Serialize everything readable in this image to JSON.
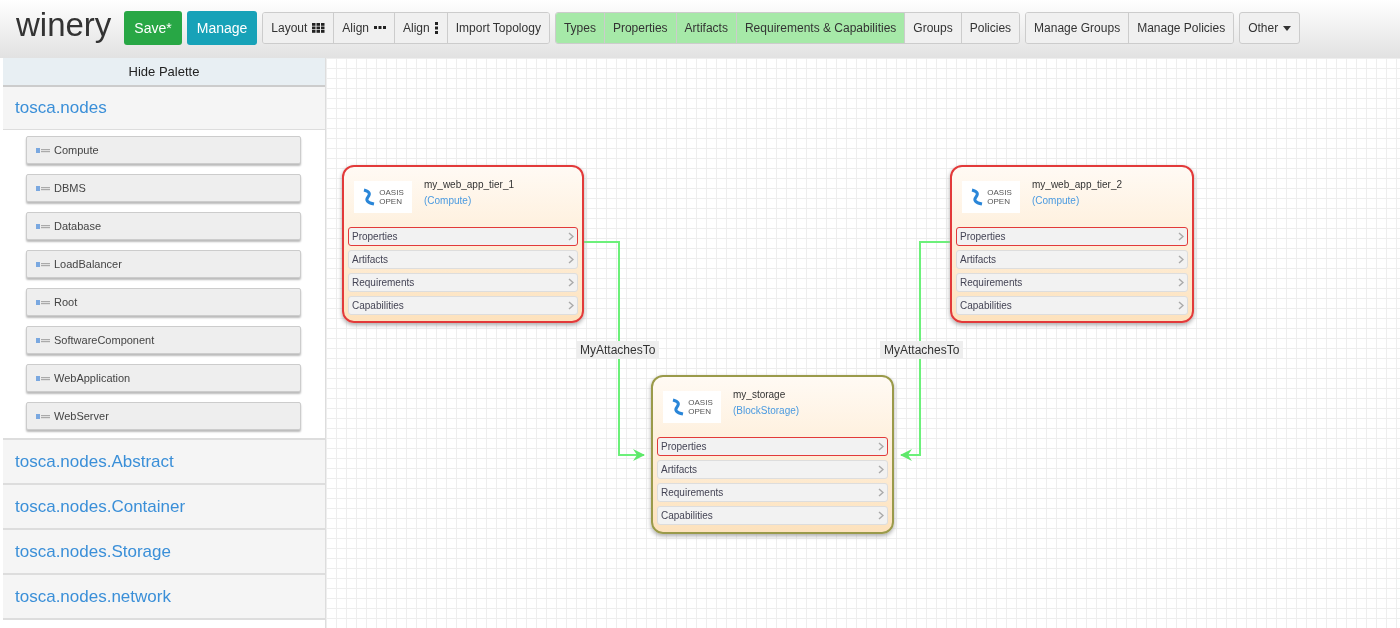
{
  "app_title": "winery",
  "toolbar": {
    "primary": [
      {
        "label": "Save*",
        "kind": "success"
      },
      {
        "label": "Manage",
        "kind": "info"
      }
    ],
    "groups": [
      [
        {
          "label": "Layout",
          "on": false
        },
        {
          "label": "Align",
          "on": false
        },
        {
          "label": "Align",
          "on": false
        },
        {
          "label": "Import Topology",
          "on": false
        }
      ],
      [
        {
          "label": "Types",
          "on": true
        },
        {
          "label": "Properties",
          "on": true
        },
        {
          "label": "Artifacts",
          "on": true
        },
        {
          "label": "Requirements & Capabilities",
          "on": true
        },
        {
          "label": "Groups",
          "on": false
        },
        {
          "label": "Policies",
          "on": false
        }
      ],
      [
        {
          "label": "Manage Groups",
          "on": false
        },
        {
          "label": "Manage Policies",
          "on": false
        }
      ]
    ],
    "dropdown": {
      "label": "Other"
    }
  },
  "palette": {
    "hide_label": "Hide Palette",
    "groups": [
      {
        "label": "tosca.nodes",
        "expanded": true,
        "children": [
          "Compute",
          "DBMS",
          "Database",
          "LoadBalancer",
          "Root",
          "SoftwareComponent",
          "WebApplication",
          "WebServer"
        ]
      },
      {
        "label": "tosca.nodes.Abstract",
        "expanded": false
      },
      {
        "label": "tosca.nodes.Container",
        "expanded": false
      },
      {
        "label": "tosca.nodes.Storage",
        "expanded": false
      },
      {
        "label": "tosca.nodes.network",
        "expanded": false
      }
    ]
  },
  "canvas": {
    "nodes": [
      {
        "name": "my_web_app_tier_1",
        "type": "(Compute)",
        "selected": true,
        "logo_text": [
          "OASIS",
          "OPEN"
        ],
        "rows": [
          {
            "label": "Properties",
            "highlighted": true
          },
          {
            "label": "Artifacts",
            "highlighted": false
          },
          {
            "label": "Requirements",
            "highlighted": false
          },
          {
            "label": "Capabilities",
            "highlighted": false
          }
        ]
      },
      {
        "name": "my_web_app_tier_2",
        "type": "(Compute)",
        "selected": true,
        "logo_text": [
          "OASIS",
          "OPEN"
        ],
        "rows": [
          {
            "label": "Properties",
            "highlighted": true
          },
          {
            "label": "Artifacts",
            "highlighted": false
          },
          {
            "label": "Requirements",
            "highlighted": false
          },
          {
            "label": "Capabilities",
            "highlighted": false
          }
        ]
      },
      {
        "name": "my_storage",
        "type": "(BlockStorage)",
        "selected": false,
        "logo_text": [
          "OASIS",
          "OPEN"
        ],
        "rows": [
          {
            "label": "Properties",
            "highlighted": true
          },
          {
            "label": "Artifacts",
            "highlighted": false
          },
          {
            "label": "Requirements",
            "highlighted": false
          },
          {
            "label": "Capabilities",
            "highlighted": false
          }
        ]
      }
    ],
    "relations": [
      {
        "label": "MyAttachesTo"
      },
      {
        "label": "MyAttachesTo"
      }
    ]
  }
}
